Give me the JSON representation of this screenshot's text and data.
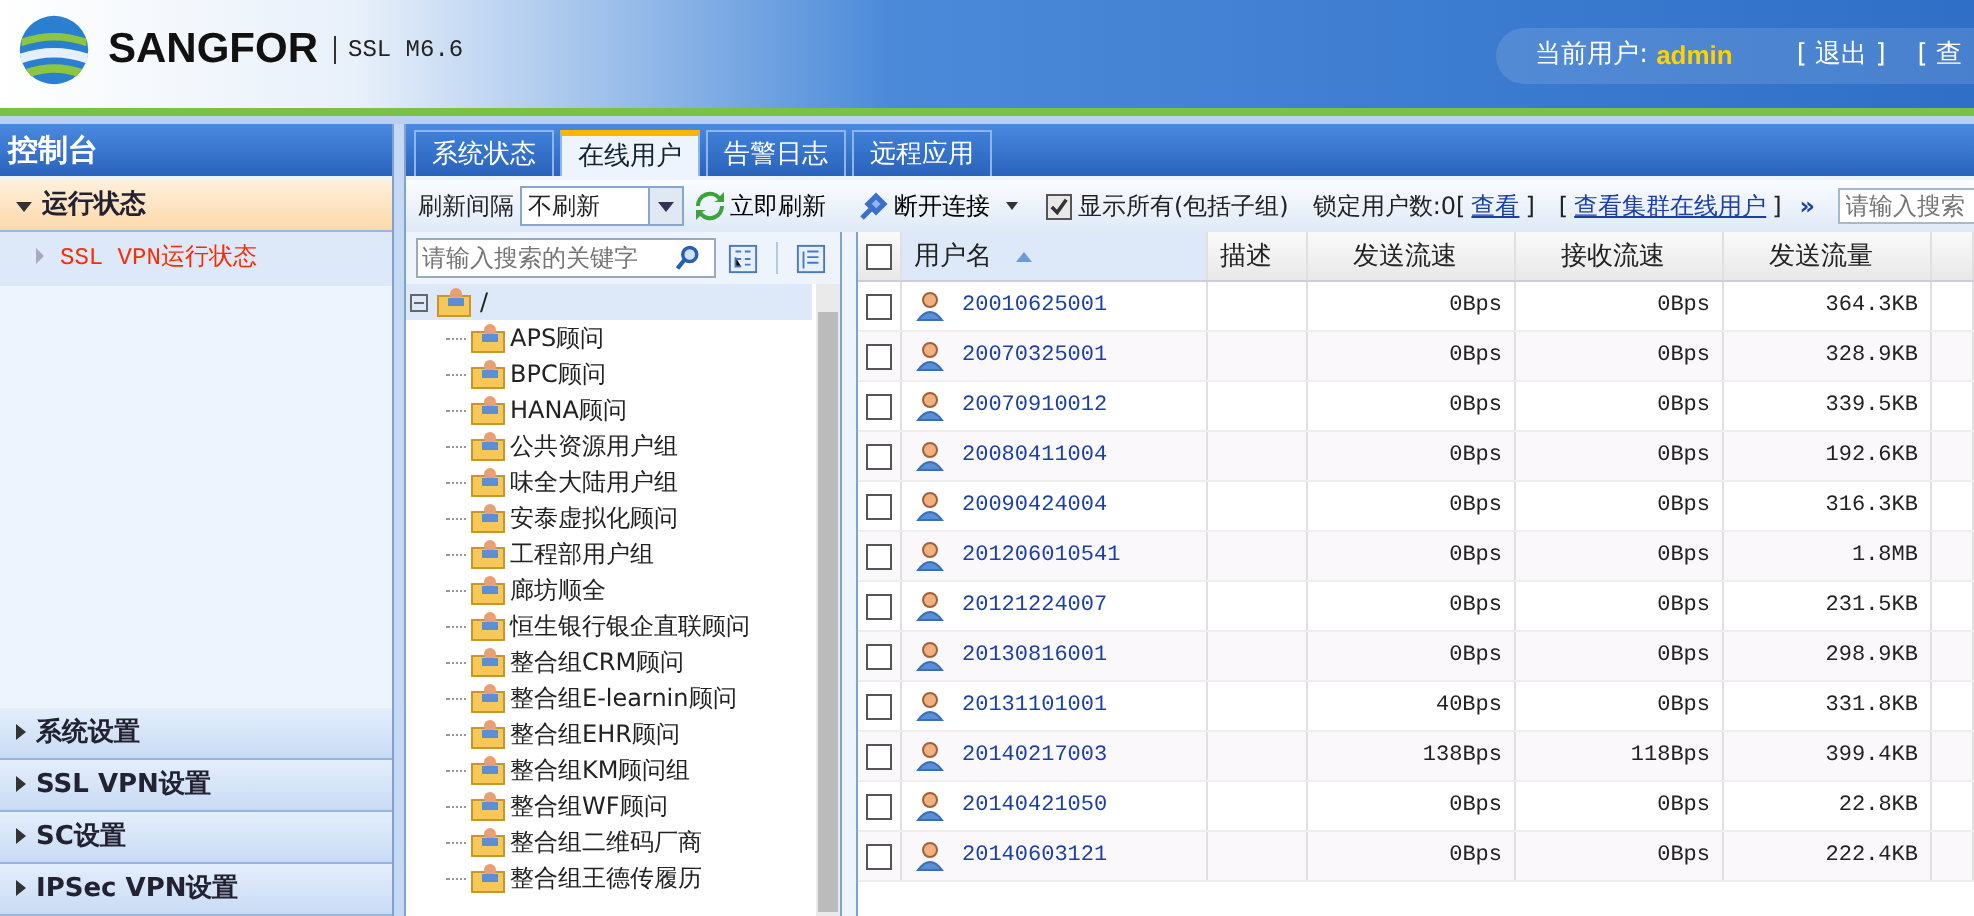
{
  "header": {
    "brand": "SANGFOR",
    "version": "SSL M6.6",
    "user_label": "当前用户:",
    "user": "admin",
    "links": [
      "[ 退出 ]",
      "[ 查"
    ]
  },
  "sidebar": {
    "title": "控制台",
    "sections": [
      {
        "label": "运行状态",
        "expanded": true,
        "children": [
          {
            "label": "SSL VPN运行状态",
            "selected": true
          }
        ]
      },
      {
        "label": "系统设置",
        "expanded": false
      },
      {
        "label": "SSL VPN设置",
        "expanded": false
      },
      {
        "label": "SC设置",
        "expanded": false
      },
      {
        "label": "IPSec VPN设置",
        "expanded": false
      }
    ]
  },
  "tabs": [
    {
      "label": "系统状态",
      "selected": false
    },
    {
      "label": "在线用户",
      "selected": true
    },
    {
      "label": "告警日志",
      "selected": false
    },
    {
      "label": "远程应用",
      "selected": false
    }
  ],
  "toolbar": {
    "interval_label": "刷新间隔",
    "interval": "不刷新",
    "refresh": "立即刷新",
    "disconnect": "断开连接",
    "show_all": {
      "label": "显示所有(包括子组)",
      "checked": true
    },
    "locked_label": "锁定用户数:0[",
    "locked_link": "查看",
    "locked_end": "]",
    "cluster_open": "[",
    "cluster_link": "查看集群在线用户",
    "cluster_end": "]",
    "more": "»",
    "search_placeholder": "请输入搜索"
  },
  "tree": {
    "search_placeholder": "请输入搜索的关键字",
    "root": {
      "label": "/",
      "expanded": true,
      "children": [
        {
          "label": "APS顾问"
        },
        {
          "label": "BPC顾问"
        },
        {
          "label": "HANA顾问"
        },
        {
          "label": "公共资源用户组"
        },
        {
          "label": "味全大陆用户组"
        },
        {
          "label": "安泰虚拟化顾问"
        },
        {
          "label": "工程部用户组"
        },
        {
          "label": "廊坊顺全"
        },
        {
          "label": "恒生银行银企直联顾问"
        },
        {
          "label": "整合组CRM顾问"
        },
        {
          "label": "整合组E-learnin顾问"
        },
        {
          "label": "整合组EHR顾问"
        },
        {
          "label": "整合组KM顾问组"
        },
        {
          "label": "整合组WF顾问"
        },
        {
          "label": "整合组二维码厂商"
        },
        {
          "label": "整合组王德传履历"
        }
      ]
    }
  },
  "table": {
    "select_all_checked": false,
    "columns": [
      "用户名",
      "描述",
      "发送流速",
      "接收流速",
      "发送流量"
    ],
    "rows": [
      {
        "checked": false,
        "cells": [
          "20010625001",
          "",
          "0Bps",
          "0Bps",
          "364.3KB"
        ]
      },
      {
        "checked": false,
        "cells": [
          "20070325001",
          "",
          "0Bps",
          "0Bps",
          "328.9KB"
        ]
      },
      {
        "checked": false,
        "cells": [
          "20070910012",
          "",
          "0Bps",
          "0Bps",
          "339.5KB"
        ]
      },
      {
        "checked": false,
        "cells": [
          "20080411004",
          "",
          "0Bps",
          "0Bps",
          "192.6KB"
        ]
      },
      {
        "checked": false,
        "cells": [
          "20090424004",
          "",
          "0Bps",
          "0Bps",
          "316.3KB"
        ]
      },
      {
        "checked": false,
        "cells": [
          "201206010541",
          "",
          "0Bps",
          "0Bps",
          "1.8MB"
        ]
      },
      {
        "checked": false,
        "cells": [
          "20121224007",
          "",
          "0Bps",
          "0Bps",
          "231.5KB"
        ]
      },
      {
        "checked": false,
        "cells": [
          "20130816001",
          "",
          "0Bps",
          "0Bps",
          "298.9KB"
        ]
      },
      {
        "checked": false,
        "cells": [
          "20131101001",
          "",
          "40Bps",
          "0Bps",
          "331.8KB"
        ]
      },
      {
        "checked": false,
        "cells": [
          "20140217003",
          "",
          "138Bps",
          "118Bps",
          "399.4KB"
        ]
      },
      {
        "checked": false,
        "cells": [
          "20140421050",
          "",
          "0Bps",
          "0Bps",
          "22.8KB"
        ]
      },
      {
        "checked": false,
        "cells": [
          "20140603121",
          "",
          "0Bps",
          "0Bps",
          "222.4KB"
        ]
      }
    ]
  }
}
